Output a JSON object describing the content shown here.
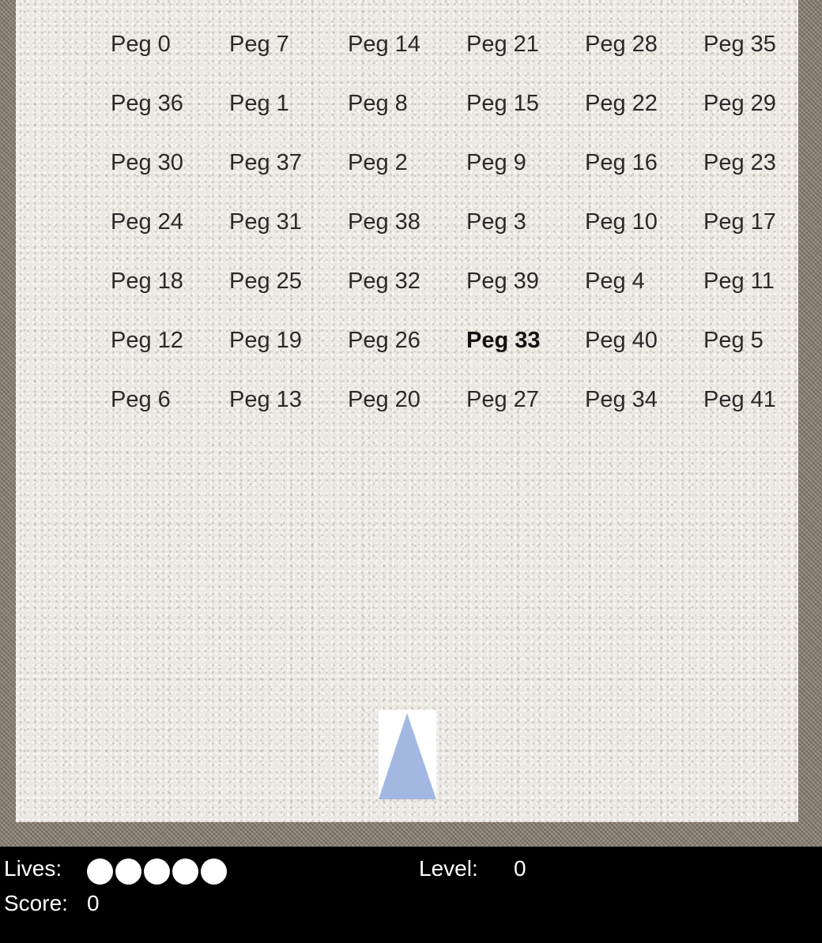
{
  "pegs": [
    [
      "Peg 0",
      "Peg 7",
      "Peg 14",
      "Peg 21",
      "Peg 28",
      "Peg 35"
    ],
    [
      "Peg 36",
      "Peg 1",
      "Peg 8",
      "Peg 15",
      "Peg 22",
      "Peg 29"
    ],
    [
      "Peg 30",
      "Peg 37",
      "Peg 2",
      "Peg 9",
      "Peg 16",
      "Peg 23"
    ],
    [
      "Peg 24",
      "Peg 31",
      "Peg 38",
      "Peg 3",
      "Peg 10",
      "Peg 17"
    ],
    [
      "Peg 18",
      "Peg 25",
      "Peg 32",
      "Peg 39",
      "Peg 4",
      "Peg 11"
    ],
    [
      "Peg 12",
      "Peg 19",
      "Peg 26",
      "Peg 33",
      "Peg 40",
      "Peg 5"
    ],
    [
      "Peg 6",
      "Peg 13",
      "Peg 20",
      "Peg 27",
      "Peg 34",
      "Peg 41"
    ]
  ],
  "highlighted_peg": "Peg 33",
  "launcher": {
    "color": "#a3b8e0",
    "icon": "triangle-launcher-icon"
  },
  "hud": {
    "lives_label": "Lives:",
    "lives_count": 5,
    "level_label": "Level:",
    "level_value": "0",
    "score_label": "Score:",
    "score_value": "0"
  }
}
